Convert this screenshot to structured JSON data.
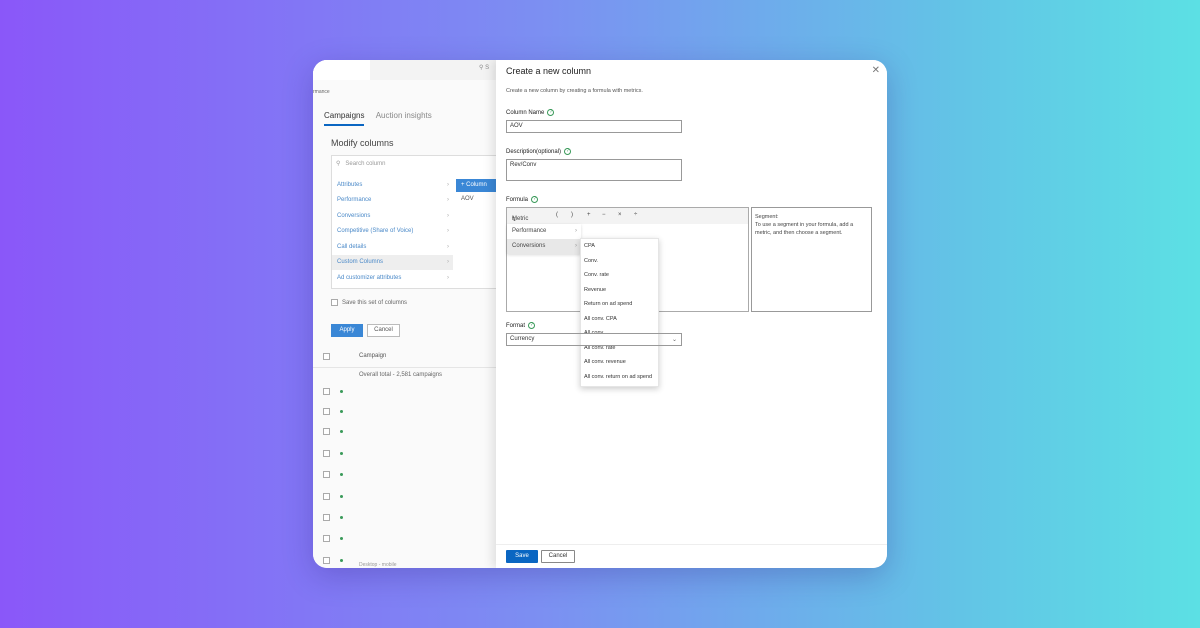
{
  "background_app": {
    "search_fragment": "S",
    "breadcrumb": "rmance",
    "tabs": [
      "Campaigns",
      "Auction insights"
    ],
    "modify_title": "Modify columns",
    "search_placeholder": "Search column",
    "categories": [
      "Attributes",
      "Performance",
      "Conversions",
      "Competitive (Share of Voice)",
      "Call details",
      "Custom Columns",
      "Ad customizer attributes"
    ],
    "selected_category": "Custom Columns",
    "add_column_label": "+ Column",
    "custom_column_item": "AOV",
    "save_set_label": "Save this set of columns",
    "apply_label": "Apply",
    "cancel_label": "Cancel",
    "table_header": "Campaign",
    "overall_total": "Overall total - 2,581 campaigns",
    "footer_fragment": "Desktop - mobile"
  },
  "dialog": {
    "title": "Create a new column",
    "close_icon": "close-icon",
    "subtitle": "Create a new column by creating a formula with metrics.",
    "column_name_label": "Column Name",
    "column_name_value": "AOV",
    "description_label": "Description(optional)",
    "description_value": "Rev/Conv",
    "formula_label": "Formula",
    "toolbar": {
      "metric_label": "Metric",
      "open_paren": "(",
      "close_paren": ")",
      "plus": "+",
      "minus": "−",
      "times": "×",
      "divide": "÷"
    },
    "metric_menu": [
      "Performance",
      "Conversions"
    ],
    "selected_metric_group": "Conversions",
    "conversion_metrics": [
      "CPA",
      "Conv.",
      "Conv. rate",
      "Revenue",
      "Return on ad spend",
      "All conv. CPA",
      "All conv.",
      "All conv. rate",
      "All conv. revenue",
      "All conv. return on ad spend"
    ],
    "segment_title": "Segment:",
    "segment_text": "To use a segment in your formula, add a metric, and then choose a segment.",
    "format_label": "Format",
    "format_value": "Currency",
    "save_label": "Save",
    "cancel_label": "Cancel"
  },
  "colors": {
    "primary": "#0a66c2",
    "bg_gradient_start": "#8a57f9",
    "bg_gradient_end": "#5ce0e4"
  }
}
